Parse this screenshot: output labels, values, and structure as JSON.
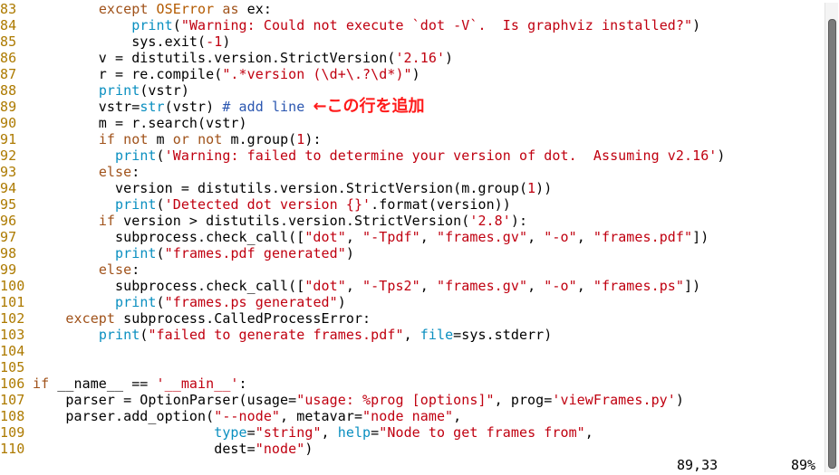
{
  "editor": {
    "lines": [
      {
        "n": "83",
        "t": [
          [
            "",
            "        "
          ],
          [
            "kw",
            "except"
          ],
          [
            "",
            " "
          ],
          [
            "ex",
            "OSError"
          ],
          [
            "",
            " "
          ],
          [
            "kw",
            "as"
          ],
          [
            "",
            " ex:"
          ]
        ]
      },
      {
        "n": "84",
        "t": [
          [
            "",
            "            "
          ],
          [
            "bi",
            "print"
          ],
          [
            "",
            "("
          ],
          [
            "st",
            "\"Warning: Could not execute `dot -V`.  Is graphviz installed?\""
          ],
          [
            "",
            ")"
          ]
        ]
      },
      {
        "n": "85",
        "t": [
          [
            "",
            "            sys.exit("
          ],
          [
            "st",
            "-1"
          ],
          [
            "",
            ")"
          ]
        ]
      },
      {
        "n": "86",
        "t": [
          [
            "",
            "        v = distutils.version.StrictVersion("
          ],
          [
            "st",
            "'2.16'"
          ],
          [
            "",
            ")"
          ]
        ]
      },
      {
        "n": "87",
        "t": [
          [
            "",
            "        r = re.compile("
          ],
          [
            "st",
            "\".*version (\\d+\\.?\\d*)\""
          ],
          [
            "",
            ")"
          ]
        ]
      },
      {
        "n": "88",
        "t": [
          [
            "",
            "        "
          ],
          [
            "bi",
            "print"
          ],
          [
            "",
            "(vstr)"
          ]
        ]
      },
      {
        "n": "89",
        "t": [
          [
            "",
            "        vstr="
          ],
          [
            "bi",
            "str"
          ],
          [
            "",
            "(vstr) "
          ],
          [
            "cm",
            "# add line"
          ],
          [
            "",
            " "
          ],
          [
            "note",
            "←この行を追加"
          ]
        ]
      },
      {
        "n": "90",
        "t": [
          [
            "",
            "        m = r.search(vstr)"
          ]
        ]
      },
      {
        "n": "91",
        "t": [
          [
            "",
            "        "
          ],
          [
            "kw",
            "if"
          ],
          [
            "",
            " "
          ],
          [
            "kw",
            "not"
          ],
          [
            "",
            " m "
          ],
          [
            "kw",
            "or"
          ],
          [
            "",
            " "
          ],
          [
            "kw",
            "not"
          ],
          [
            "",
            " m.group("
          ],
          [
            "st",
            "1"
          ],
          [
            "",
            "):"
          ]
        ]
      },
      {
        "n": "92",
        "t": [
          [
            "",
            "          "
          ],
          [
            "bi",
            "print"
          ],
          [
            "",
            "("
          ],
          [
            "st",
            "'Warning: failed to determine your version of dot.  Assuming v2.16'"
          ],
          [
            "",
            ")"
          ]
        ]
      },
      {
        "n": "93",
        "t": [
          [
            "",
            "        "
          ],
          [
            "kw",
            "else"
          ],
          [
            "",
            ":"
          ]
        ]
      },
      {
        "n": "94",
        "t": [
          [
            "",
            "          version = distutils.version.StrictVersion(m.group("
          ],
          [
            "st",
            "1"
          ],
          [
            "",
            "))"
          ]
        ]
      },
      {
        "n": "95",
        "t": [
          [
            "",
            "          "
          ],
          [
            "bi",
            "print"
          ],
          [
            "",
            "("
          ],
          [
            "st",
            "'Detected dot version {}'"
          ],
          [
            "",
            ".format(version))"
          ]
        ]
      },
      {
        "n": "96",
        "t": [
          [
            "",
            "        "
          ],
          [
            "kw",
            "if"
          ],
          [
            "",
            " version > distutils.version.StrictVersion("
          ],
          [
            "st",
            "'2.8'"
          ],
          [
            "",
            "):"
          ]
        ]
      },
      {
        "n": "97",
        "t": [
          [
            "",
            "          subprocess.check_call(["
          ],
          [
            "st",
            "\"dot\""
          ],
          [
            "",
            ", "
          ],
          [
            "st",
            "\"-Tpdf\""
          ],
          [
            "",
            ", "
          ],
          [
            "st",
            "\"frames.gv\""
          ],
          [
            "",
            ", "
          ],
          [
            "st",
            "\"-o\""
          ],
          [
            "",
            ", "
          ],
          [
            "st",
            "\"frames.pdf\""
          ],
          [
            "",
            "])"
          ]
        ]
      },
      {
        "n": "98",
        "t": [
          [
            "",
            "          "
          ],
          [
            "bi",
            "print"
          ],
          [
            "",
            "("
          ],
          [
            "st",
            "\"frames.pdf generated\""
          ],
          [
            "",
            ")"
          ]
        ]
      },
      {
        "n": "99",
        "t": [
          [
            "",
            "        "
          ],
          [
            "kw",
            "else"
          ],
          [
            "",
            ":"
          ]
        ]
      },
      {
        "n": "100",
        "t": [
          [
            "",
            "          subprocess.check_call(["
          ],
          [
            "st",
            "\"dot\""
          ],
          [
            "",
            ", "
          ],
          [
            "st",
            "\"-Tps2\""
          ],
          [
            "",
            ", "
          ],
          [
            "st",
            "\"frames.gv\""
          ],
          [
            "",
            ", "
          ],
          [
            "st",
            "\"-o\""
          ],
          [
            "",
            ", "
          ],
          [
            "st",
            "\"frames.ps\""
          ],
          [
            "",
            "])"
          ]
        ]
      },
      {
        "n": "101",
        "t": [
          [
            "",
            "          "
          ],
          [
            "bi",
            "print"
          ],
          [
            "",
            "("
          ],
          [
            "st",
            "\"frames.ps generated\""
          ],
          [
            "",
            ")"
          ]
        ]
      },
      {
        "n": "102",
        "t": [
          [
            "",
            "    "
          ],
          [
            "kw",
            "except"
          ],
          [
            "",
            " subprocess.CalledProcessError:"
          ]
        ]
      },
      {
        "n": "103",
        "t": [
          [
            "",
            "        "
          ],
          [
            "bi",
            "print"
          ],
          [
            "",
            "("
          ],
          [
            "st",
            "\"failed to generate frames.pdf\""
          ],
          [
            "",
            ", "
          ],
          [
            "bi",
            "file"
          ],
          [
            "",
            "=sys.stderr)"
          ]
        ]
      },
      {
        "n": "104",
        "t": []
      },
      {
        "n": "105",
        "t": []
      },
      {
        "n": "106",
        "t": [
          [
            "kw",
            "if"
          ],
          [
            "",
            " __name__ == "
          ],
          [
            "st",
            "'__main__'"
          ],
          [
            "",
            ":"
          ]
        ]
      },
      {
        "n": "107",
        "t": [
          [
            "",
            "    parser = OptionParser(usage="
          ],
          [
            "st",
            "\"usage: %prog [options]\""
          ],
          [
            "",
            ", prog="
          ],
          [
            "st",
            "'viewFrames.py'"
          ],
          [
            "",
            ")"
          ]
        ]
      },
      {
        "n": "108",
        "t": [
          [
            "",
            "    parser.add_option("
          ],
          [
            "st",
            "\"--node\""
          ],
          [
            "",
            ", metavar="
          ],
          [
            "st",
            "\"node name\""
          ],
          [
            "",
            ","
          ]
        ]
      },
      {
        "n": "109",
        "t": [
          [
            "",
            "                      "
          ],
          [
            "bi",
            "type"
          ],
          [
            "",
            "="
          ],
          [
            "st",
            "\"string\""
          ],
          [
            "",
            ", "
          ],
          [
            "bi",
            "help"
          ],
          [
            "",
            "="
          ],
          [
            "st",
            "\"Node to get frames from\""
          ],
          [
            "",
            ","
          ]
        ]
      },
      {
        "n": "110",
        "t": [
          [
            "",
            "                      dest="
          ],
          [
            "st",
            "\"node\""
          ],
          [
            "",
            ")"
          ]
        ]
      }
    ]
  },
  "status": {
    "cursor": "89,33",
    "percent": "89%"
  },
  "scroll": {
    "position": 0.89
  },
  "colors": {
    "line_number": "#ad7a00",
    "keyword": "#a0521a",
    "builtin": "#0a8fc0",
    "string": "#c00010",
    "comment": "#2a56b0",
    "annotation": "#ff1a1a"
  }
}
